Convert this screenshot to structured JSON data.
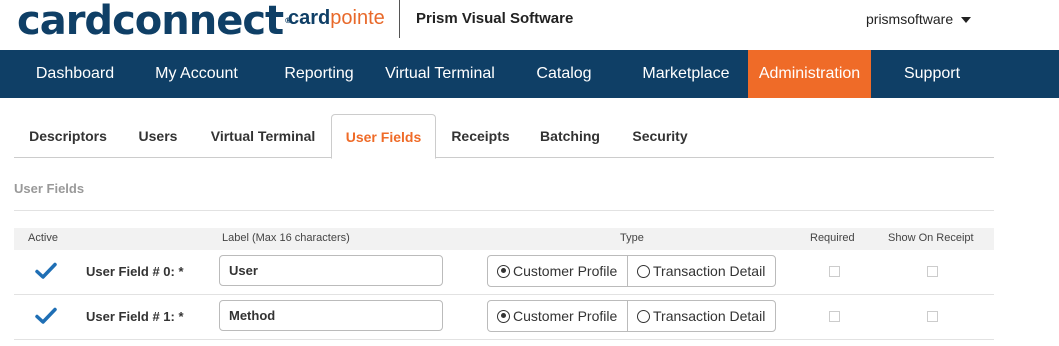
{
  "header": {
    "logo_main": "cardconnect",
    "logo_reg": "®",
    "logo_product_card": "card",
    "logo_product_pointe": "pointe",
    "merchant": "Prism Visual Software",
    "user": "prismsoftware",
    "user_menu_icon": "chevron-down-icon"
  },
  "nav": {
    "items": [
      {
        "label": "Dashboard"
      },
      {
        "label": "My Account"
      },
      {
        "label": "Reporting"
      },
      {
        "label": "Virtual Terminal"
      },
      {
        "label": "Catalog"
      },
      {
        "label": "Marketplace"
      },
      {
        "label": "Administration"
      },
      {
        "label": "Support"
      }
    ],
    "active": "Administration"
  },
  "tabs": {
    "items": [
      {
        "label": "Descriptors"
      },
      {
        "label": "Users"
      },
      {
        "label": "Virtual Terminal"
      },
      {
        "label": "User Fields"
      },
      {
        "label": "Receipts"
      },
      {
        "label": "Batching"
      },
      {
        "label": "Security"
      }
    ],
    "active": "User Fields"
  },
  "section": {
    "title": "User Fields"
  },
  "table": {
    "headers": {
      "active": "Active",
      "label": "Label (Max 16 characters)",
      "type": "Type",
      "required": "Required",
      "receipt": "Show On Receipt"
    },
    "type_options": [
      "Customer Profile",
      "Transaction Detail"
    ],
    "rows": [
      {
        "active": true,
        "name": "User Field # 0: *",
        "label_value": "User",
        "type": "Customer Profile",
        "required": false,
        "show_on_receipt": false
      },
      {
        "active": true,
        "name": "User Field # 1: *",
        "label_value": "Method",
        "type": "Customer Profile",
        "required": false,
        "show_on_receipt": false
      }
    ]
  },
  "colors": {
    "brand_navy": "#0f3f66",
    "accent_orange": "#ef6b28",
    "check_blue": "#1f6fb5"
  }
}
